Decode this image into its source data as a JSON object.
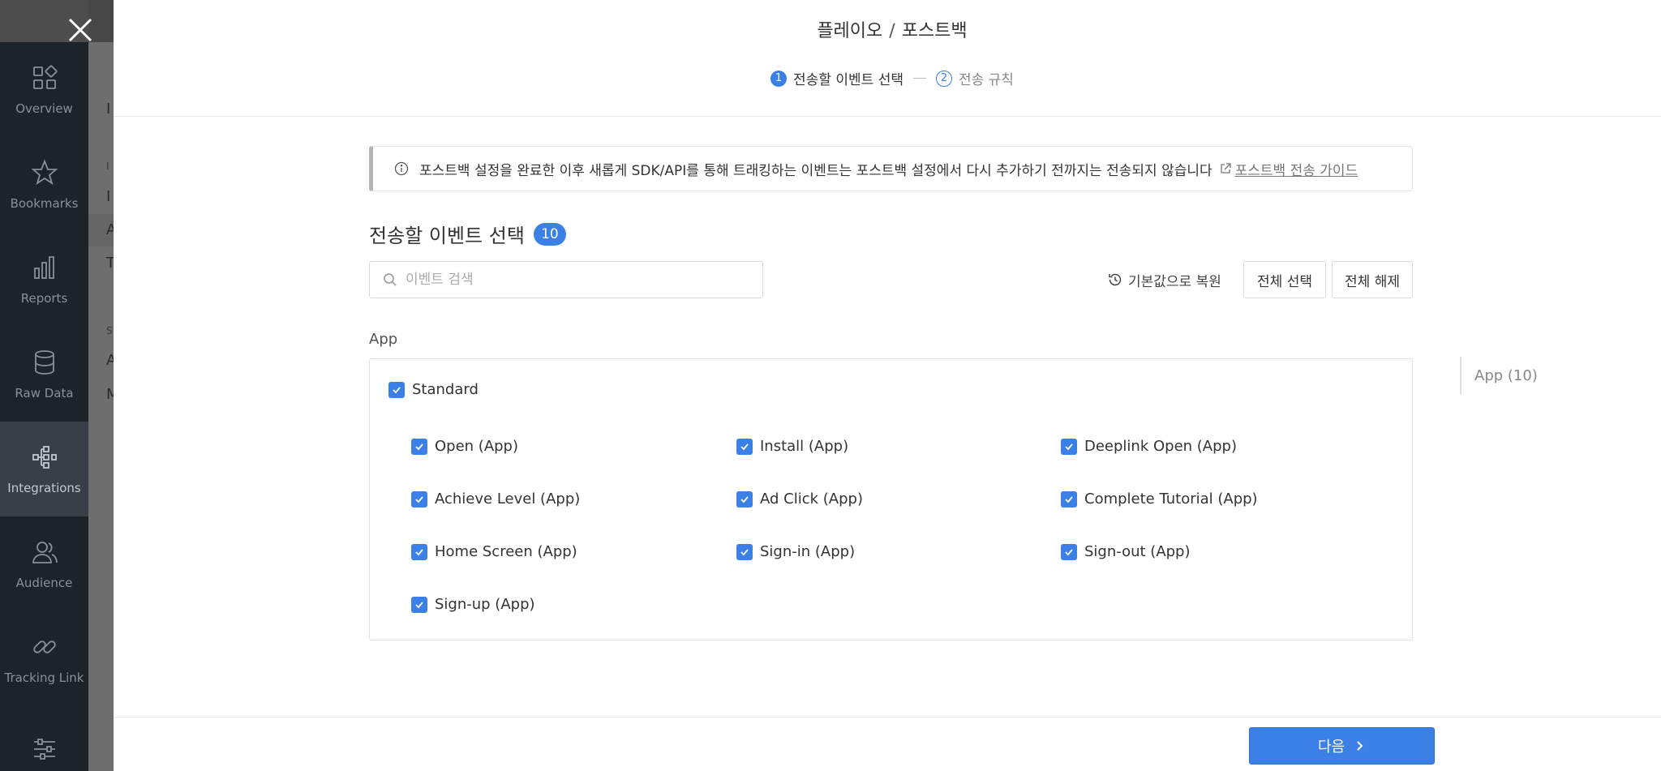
{
  "sidebar": {
    "items": [
      {
        "label": "Overview",
        "icon": "overview-icon"
      },
      {
        "label": "Bookmarks",
        "icon": "star-icon"
      },
      {
        "label": "Reports",
        "icon": "bar-chart-icon"
      },
      {
        "label": "Raw Data",
        "icon": "database-icon"
      },
      {
        "label": "Integrations",
        "icon": "integrations-icon",
        "active": true
      },
      {
        "label": "Audience",
        "icon": "audience-icon"
      },
      {
        "label": "Tracking Link",
        "icon": "link-icon"
      },
      {
        "label": "",
        "icon": "sliders-icon"
      }
    ]
  },
  "background_page": {
    "letters": [
      "I",
      "I",
      "I",
      "A",
      "T",
      "S",
      "A",
      "M"
    ]
  },
  "modal": {
    "title_left": "플레이오",
    "title_sep": "/",
    "title_right": "포스트백",
    "steps": [
      {
        "num": "1",
        "label": "전송할 이벤트 선택"
      },
      {
        "num": "2",
        "label": "전송 규칙"
      }
    ],
    "notice": {
      "text": "포스트백 설정을 완료한 이후 새롭게 SDK/API를 통해 트래킹하는 이벤트는 포스트백 설정에서 다시 추가하기 전까지는 전송되지 않습니다",
      "link": "포스트백 전송 가이드"
    },
    "section_title": "전송할 이벤트 선택",
    "selected_count": "10",
    "search": {
      "placeholder": "이벤트 검색",
      "value": ""
    },
    "restore_label": "기본값으로 복원",
    "select_all_label": "전체 선택",
    "deselect_all_label": "전체 해제",
    "group_label": "App",
    "category_label": "Standard",
    "events": [
      {
        "label": "Open (App)",
        "checked": true
      },
      {
        "label": "Install (App)",
        "checked": true
      },
      {
        "label": "Deeplink Open (App)",
        "checked": true
      },
      {
        "label": "Achieve Level (App)",
        "checked": true
      },
      {
        "label": "Ad Click (App)",
        "checked": true
      },
      {
        "label": "Complete Tutorial (App)",
        "checked": true
      },
      {
        "label": "Home Screen (App)",
        "checked": true
      },
      {
        "label": "Sign-in (App)",
        "checked": true
      },
      {
        "label": "Sign-out (App)",
        "checked": true
      },
      {
        "label": "Sign-up (App)",
        "checked": true
      }
    ],
    "side_index_label": "App (10)",
    "next_label": "다음"
  },
  "colors": {
    "accent": "#3a80e6",
    "sidebar_bg": "#1e232a"
  }
}
